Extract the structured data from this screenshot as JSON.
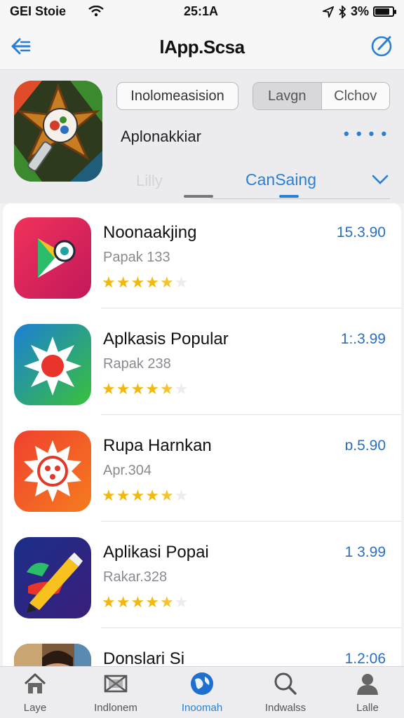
{
  "status_bar": {
    "carrier": "GEI Stoie",
    "time": "25:1A",
    "battery": "3%",
    "battery_level": 0.85
  },
  "nav": {
    "title": "lApp.Scsa",
    "back_icon": "back-arrow-icon",
    "compose_icon": "compose-icon"
  },
  "header": {
    "field_button": "Inolomeasision",
    "segment_left": "Lavgn",
    "segment_right": "Clchov",
    "subtitle": "Aplonakkiar",
    "more_dots": "• • • •",
    "tab_faded": "Lilly",
    "tab_active": "CanSaing"
  },
  "apps": [
    {
      "name": "Noonaakjing",
      "subtitle": "Papak 133",
      "price": "15.3.90",
      "rating": 4.5
    },
    {
      "name": "Aplkasis Popular",
      "subtitle": "Rapak 238",
      "price": "1:.3.99",
      "rating": 4.5
    },
    {
      "name": "Rupa Harnkan",
      "subtitle": "Apr.304",
      "price": "ɒ.5.90",
      "rating": 4.5
    },
    {
      "name": "Aplikasi Popai",
      "subtitle": "Rakar.328",
      "price": "1 3.99",
      "rating": 4.5
    },
    {
      "name": "Donslari Si",
      "subtitle": "",
      "price": "1.2:06",
      "rating": 0
    }
  ],
  "tabbar": [
    {
      "label": "Laye",
      "icon": "home-icon"
    },
    {
      "label": "Indlonem",
      "icon": "mail-icon"
    },
    {
      "label": "Inoomah",
      "icon": "globe-icon",
      "active": true
    },
    {
      "label": "Indwalss",
      "icon": "search-icon"
    },
    {
      "label": "Lalle",
      "icon": "profile-icon"
    }
  ],
  "colors": {
    "accent": "#2a7fd4",
    "price": "#2a6fc4",
    "star": "#f2b90c"
  }
}
